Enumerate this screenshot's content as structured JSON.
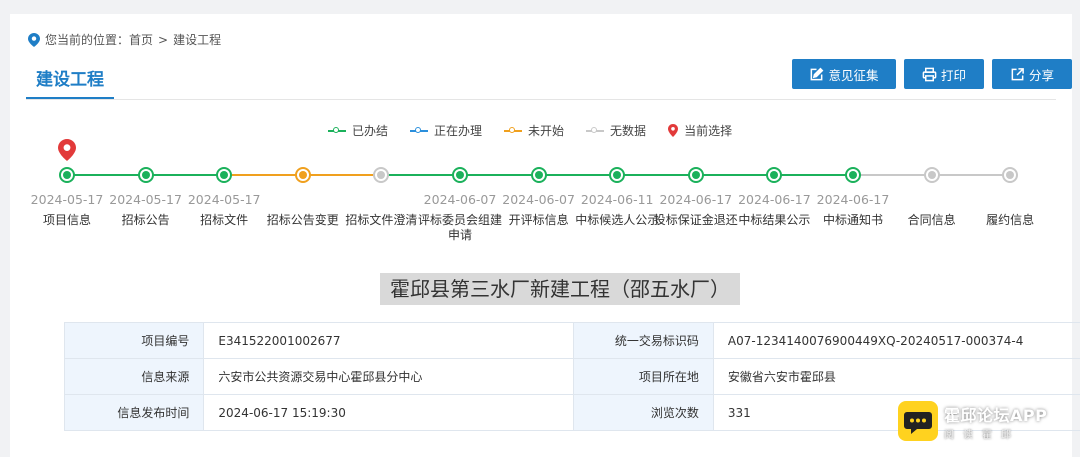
{
  "breadcrumb": {
    "prefix": "您当前的位置：",
    "home": "首页",
    "separator": ">",
    "current": "建设工程"
  },
  "page_title": "建设工程",
  "actions": {
    "feedback": "意见征集",
    "print": "打印",
    "share": "分享"
  },
  "legend": [
    {
      "label": "已办结",
      "color": "#1bb15b"
    },
    {
      "label": "正在办理",
      "color": "#2b8fdc"
    },
    {
      "label": "未开始",
      "color": "#f0a01e"
    },
    {
      "label": "无数据",
      "color": "#c8c8c8"
    },
    {
      "label": "当前选择",
      "color": "#e23a3a"
    }
  ],
  "stages": [
    {
      "date": "2024-05-17",
      "name": "项目信息",
      "status": "done"
    },
    {
      "date": "2024-05-17",
      "name": "招标公告",
      "status": "done"
    },
    {
      "date": "2024-05-17",
      "name": "招标文件",
      "status": "done"
    },
    {
      "date": "",
      "name": "招标公告变更",
      "status": "notstarted"
    },
    {
      "date": "",
      "name": "招标文件澄清",
      "status": "nodata"
    },
    {
      "date": "2024-06-07",
      "name": "评标委员会组建申请",
      "status": "done"
    },
    {
      "date": "2024-06-07",
      "name": "开评标信息",
      "status": "done"
    },
    {
      "date": "2024-06-11",
      "name": "中标候选人公示",
      "status": "done"
    },
    {
      "date": "2024-06-17",
      "name": "投标保证金退还",
      "status": "done"
    },
    {
      "date": "2024-06-17",
      "name": "中标结果公示",
      "status": "done"
    },
    {
      "date": "2024-06-17",
      "name": "中标通知书",
      "status": "done"
    },
    {
      "date": "",
      "name": "合同信息",
      "status": "nodata"
    },
    {
      "date": "",
      "name": "履约信息",
      "status": "nodata"
    }
  ],
  "project_title": "霍邱县第三水厂新建工程（邵五水厂）",
  "info": {
    "project_no_label": "项目编号",
    "project_no": "E341522001002677",
    "trade_code_label": "统一交易标识码",
    "trade_code": "A07-1234140076900449XQ-20240517-000374-4",
    "source_label": "信息来源",
    "source": "六安市公共资源交易中心霍邱县分中心",
    "location_label": "项目所在地",
    "location": "安徽省六安市霍邱县",
    "publish_time_label": "信息发布时间",
    "publish_time": "2024-06-17 15:19:30",
    "views_label": "浏览次数",
    "views": "331"
  },
  "watermark": {
    "title": "霍邱论坛APP",
    "subtitle": "阅读霍邱"
  }
}
